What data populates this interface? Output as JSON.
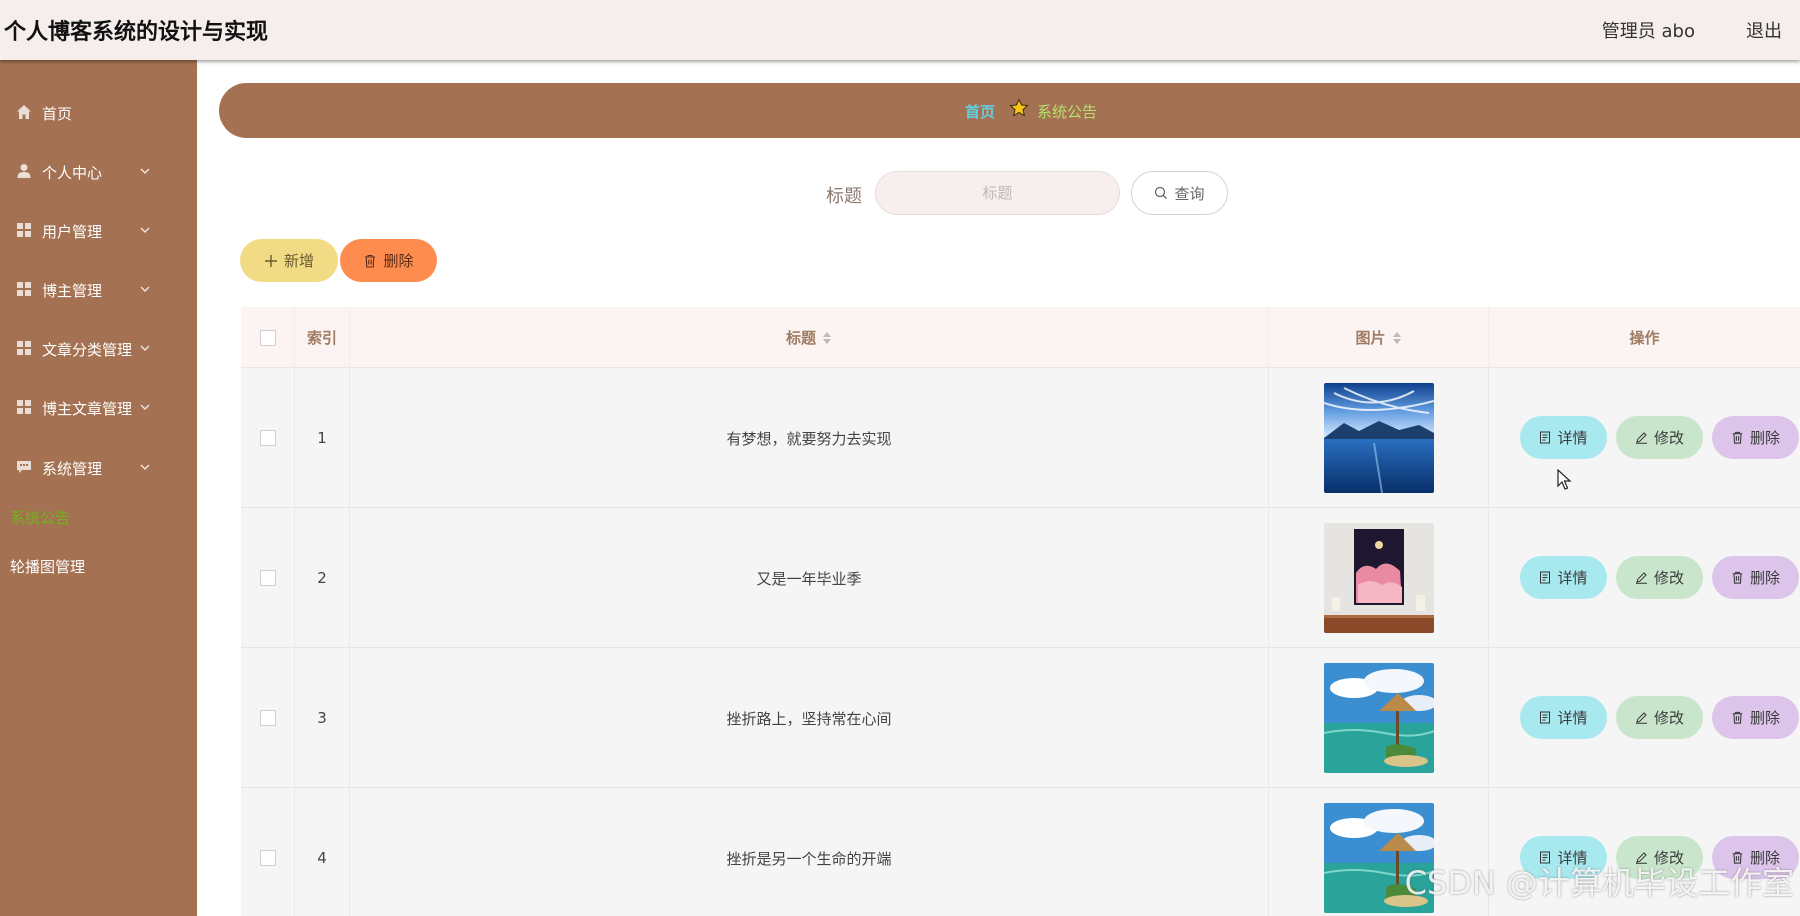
{
  "header": {
    "title": "个人博客系统的设计与实现",
    "user": "管理员 abo",
    "logout": "退出"
  },
  "sidebar": {
    "items": [
      {
        "label": "首页",
        "icon": "home-icon",
        "expandable": false
      },
      {
        "label": "个人中心",
        "icon": "user-icon",
        "expandable": true
      },
      {
        "label": "用户管理",
        "icon": "grid-icon",
        "expandable": true
      },
      {
        "label": "博主管理",
        "icon": "grid-icon",
        "expandable": true
      },
      {
        "label": "文章分类管理",
        "icon": "grid-icon",
        "expandable": true
      },
      {
        "label": "博主文章管理",
        "icon": "grid-icon",
        "expandable": true
      },
      {
        "label": "系统管理",
        "icon": "chat-icon",
        "expandable": true
      }
    ],
    "submenu": [
      {
        "label": "系统公告",
        "active": true
      },
      {
        "label": "轮播图管理",
        "active": false
      }
    ]
  },
  "breadcrumb": {
    "home": "首页",
    "current": "系统公告"
  },
  "search": {
    "label": "标题",
    "placeholder": "标题",
    "button": "查询"
  },
  "actions": {
    "add": "新增",
    "delete": "删除"
  },
  "table": {
    "columns": [
      "索引",
      "标题",
      "图片",
      "操作"
    ],
    "rows": [
      {
        "index": "1",
        "title": "有梦想，就要努力去实现",
        "image": "mountain-lake"
      },
      {
        "index": "2",
        "title": "又是一年毕业季",
        "image": "pink-clouds-poster"
      },
      {
        "index": "3",
        "title": "挫折路上，坚持常在心间",
        "image": "tropical-hut"
      },
      {
        "index": "4",
        "title": "挫折是另一个生命的开端",
        "image": "tropical-hut"
      }
    ],
    "row_actions": {
      "detail": "详情",
      "edit": "修改",
      "delete": "删除"
    }
  },
  "watermark": "CSDN @计算机毕设工作室",
  "colors": {
    "sidebar": "#a47152",
    "header": "#f6eeec",
    "submenu_active": "#6fb31d",
    "breadcrumb_home": "#5fd0e0",
    "add_button": "#f1dc85",
    "delete_button": "#ff8c4f",
    "detail_button": "#a8e8ef",
    "edit_button": "#c9e6cc",
    "row_delete_button": "#dcc4ea"
  }
}
